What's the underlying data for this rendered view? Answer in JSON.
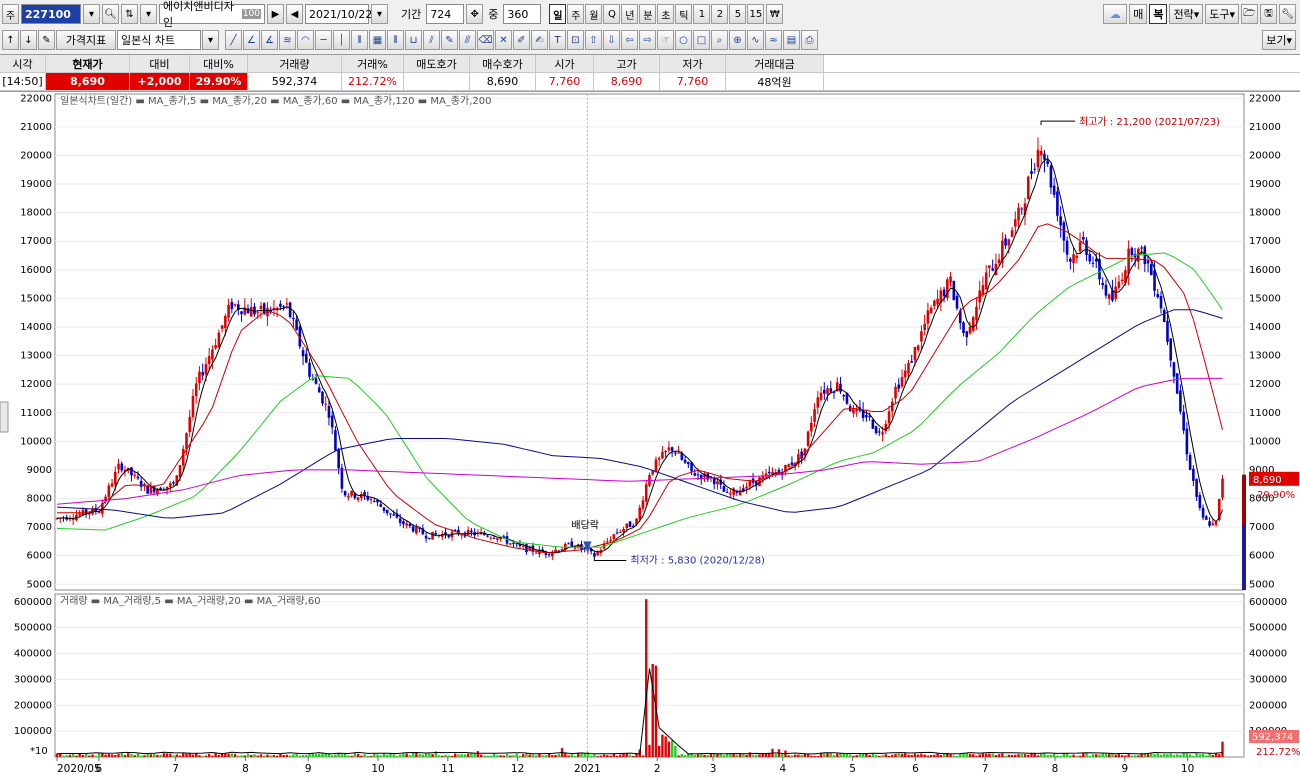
{
  "toolbar": {
    "market_label": "주",
    "code": "227100",
    "stock_name": "에이치앤비디자인",
    "stock_badge": "100",
    "date": "2021/10/22",
    "period_label": "기간",
    "period_value": "724",
    "overlap_label": "중",
    "overlap_value": "360",
    "timeframes": [
      "일",
      "주",
      "월",
      "Q",
      "년",
      "분",
      "초",
      "틱",
      "1",
      "2",
      "5",
      "15"
    ],
    "sell_label": "매",
    "dup_label": "복",
    "strategy_label": "전략",
    "tools_label": "도구",
    "price_indicator": "가격지표",
    "chart_type": "일본식 차트",
    "view_label": "보기"
  },
  "quote": {
    "headers": [
      "시각",
      "현재가",
      "대비",
      "대비%",
      "거래량",
      "거래%",
      "매도호가",
      "매수호가",
      "시가",
      "고가",
      "저가",
      "거래대금"
    ],
    "values": [
      "[14:50]",
      "8,690",
      "+2,000",
      "29.90%",
      "592,374",
      "212.72%",
      "",
      "8,690",
      "7,760",
      "8,690",
      "7,760",
      "48억원"
    ]
  },
  "colors": {
    "up": "#e00000",
    "down": "#0000c8",
    "ma5": "#000000",
    "ma20": "#cc0000",
    "ma60": "#22cc22",
    "ma120": "#0a0a8c",
    "ma200": "#cc00cc"
  },
  "chart_data": {
    "type": "candlestick",
    "price_legend": "일본식차트(일간) ▬ MA_종가,5 ▬ MA_종가,20 ▬ MA_종가,60 ▬ MA_종가,120 ▬ MA_종가,200",
    "volume_legend": "거래량 ▬ MA_거래량,5 ▬ MA_거래량,20 ▬ MA_거래량,60",
    "price_ticks": [
      5000,
      6000,
      7000,
      8000,
      9000,
      10000,
      11000,
      12000,
      13000,
      14000,
      15000,
      16000,
      17000,
      18000,
      19000,
      20000,
      21000,
      22000
    ],
    "price_ylim": [
      4800,
      22150
    ],
    "volume_ticks": [
      100000,
      200000,
      300000,
      400000,
      500000,
      600000
    ],
    "volume_ylim": [
      0,
      630000
    ],
    "volume_scale_label": "*10",
    "x_ticks": [
      "2020/05",
      "6",
      "7",
      "8",
      "9",
      "10",
      "11",
      "12",
      "2021",
      "2",
      "3",
      "4",
      "5",
      "6",
      "7",
      "8",
      "9",
      "10"
    ],
    "x_tick_index": [
      0,
      0.6,
      1.7,
      2.7,
      3.6,
      4.6,
      5.6,
      6.6,
      7.6,
      8.6,
      9.4,
      10.4,
      11.4,
      12.3,
      13.3,
      14.3,
      15.3,
      16.2
    ],
    "price_anchors": [
      [
        0,
        7300
      ],
      [
        0.6,
        7600
      ],
      [
        0.9,
        9200
      ],
      [
        1.3,
        8300
      ],
      [
        1.7,
        8500
      ],
      [
        2.0,
        12000
      ],
      [
        2.5,
        14800
      ],
      [
        2.9,
        14500
      ],
      [
        3.3,
        14700
      ],
      [
        3.6,
        12500
      ],
      [
        3.9,
        11000
      ],
      [
        4.1,
        8200
      ],
      [
        4.5,
        8000
      ],
      [
        4.9,
        7200
      ],
      [
        5.3,
        6700
      ],
      [
        5.8,
        6800
      ],
      [
        6.3,
        6700
      ],
      [
        6.6,
        6300
      ],
      [
        7.0,
        6100
      ],
      [
        7.4,
        6400
      ],
      [
        7.7,
        6000
      ],
      [
        8.0,
        6800
      ],
      [
        8.3,
        7200
      ],
      [
        8.5,
        9000
      ],
      [
        8.8,
        9800
      ],
      [
        9.1,
        8900
      ],
      [
        9.4,
        8700
      ],
      [
        9.6,
        8100
      ],
      [
        10.0,
        8600
      ],
      [
        10.4,
        9000
      ],
      [
        10.7,
        9600
      ],
      [
        10.9,
        11700
      ],
      [
        11.2,
        12000
      ],
      [
        11.4,
        11000
      ],
      [
        11.6,
        10900
      ],
      [
        11.8,
        10200
      ],
      [
        12.0,
        11800
      ],
      [
        12.2,
        12600
      ],
      [
        12.5,
        14500
      ],
      [
        12.8,
        15600
      ],
      [
        13.0,
        13600
      ],
      [
        13.3,
        15700
      ],
      [
        13.6,
        17000
      ],
      [
        13.8,
        18000
      ],
      [
        14.0,
        19800
      ],
      [
        14.1,
        20500
      ],
      [
        14.3,
        18500
      ],
      [
        14.5,
        16300
      ],
      [
        14.7,
        17000
      ],
      [
        14.9,
        16000
      ],
      [
        15.1,
        14800
      ],
      [
        15.4,
        16800
      ],
      [
        15.6,
        16400
      ],
      [
        15.8,
        15000
      ],
      [
        16.0,
        12500
      ],
      [
        16.2,
        9500
      ],
      [
        16.4,
        7300
      ],
      [
        16.6,
        7000
      ],
      [
        16.7,
        8690
      ]
    ],
    "ma20": [
      [
        0,
        7500
      ],
      [
        0.5,
        7500
      ],
      [
        1.0,
        8500
      ],
      [
        1.5,
        8400
      ],
      [
        2.2,
        11000
      ],
      [
        2.6,
        13800
      ],
      [
        3.0,
        14600
      ],
      [
        3.3,
        14300
      ],
      [
        3.8,
        12400
      ],
      [
        4.3,
        10000
      ],
      [
        4.8,
        8200
      ],
      [
        5.4,
        7100
      ],
      [
        6.0,
        6600
      ],
      [
        6.5,
        6300
      ],
      [
        7.0,
        6100
      ],
      [
        7.5,
        6200
      ],
      [
        8.0,
        6500
      ],
      [
        8.4,
        7000
      ],
      [
        8.8,
        8700
      ],
      [
        9.2,
        9000
      ],
      [
        9.6,
        8700
      ],
      [
        10.0,
        8600
      ],
      [
        10.5,
        9000
      ],
      [
        10.9,
        10100
      ],
      [
        11.3,
        11200
      ],
      [
        11.8,
        11000
      ],
      [
        12.2,
        11600
      ],
      [
        12.6,
        13200
      ],
      [
        13.0,
        14800
      ],
      [
        13.4,
        15300
      ],
      [
        13.8,
        16400
      ],
      [
        14.1,
        17700
      ],
      [
        14.5,
        17300
      ],
      [
        15.0,
        16400
      ],
      [
        15.4,
        16400
      ],
      [
        15.8,
        16300
      ],
      [
        16.2,
        15000
      ],
      [
        16.5,
        12300
      ],
      [
        16.7,
        10400
      ]
    ],
    "ma60": [
      [
        0,
        6950
      ],
      [
        0.7,
        6900
      ],
      [
        1.3,
        7400
      ],
      [
        2.0,
        8100
      ],
      [
        2.6,
        9600
      ],
      [
        3.2,
        11400
      ],
      [
        3.7,
        12300
      ],
      [
        4.2,
        12200
      ],
      [
        4.7,
        11000
      ],
      [
        5.3,
        8700
      ],
      [
        5.9,
        7200
      ],
      [
        6.5,
        6500
      ],
      [
        7.2,
        6300
      ],
      [
        7.8,
        6300
      ],
      [
        8.4,
        6800
      ],
      [
        9.0,
        7300
      ],
      [
        9.8,
        7800
      ],
      [
        10.5,
        8500
      ],
      [
        11.2,
        9300
      ],
      [
        11.7,
        9600
      ],
      [
        12.3,
        10400
      ],
      [
        12.9,
        11900
      ],
      [
        13.5,
        13100
      ],
      [
        14.0,
        14400
      ],
      [
        14.5,
        15400
      ],
      [
        15.0,
        16000
      ],
      [
        15.4,
        16500
      ],
      [
        15.9,
        16600
      ],
      [
        16.3,
        16000
      ],
      [
        16.7,
        14600
      ]
    ],
    "ma120": [
      [
        0,
        7700
      ],
      [
        0.8,
        7600
      ],
      [
        1.6,
        7300
      ],
      [
        2.4,
        7500
      ],
      [
        3.2,
        8500
      ],
      [
        4.0,
        9700
      ],
      [
        4.8,
        10100
      ],
      [
        5.6,
        10100
      ],
      [
        6.4,
        9900
      ],
      [
        7.1,
        9500
      ],
      [
        7.8,
        9400
      ],
      [
        8.4,
        9100
      ],
      [
        9.1,
        8500
      ],
      [
        9.8,
        7900
      ],
      [
        10.5,
        7500
      ],
      [
        11.2,
        7700
      ],
      [
        11.8,
        8300
      ],
      [
        12.5,
        9000
      ],
      [
        13.1,
        10200
      ],
      [
        13.7,
        11400
      ],
      [
        14.3,
        12300
      ],
      [
        14.9,
        13200
      ],
      [
        15.5,
        14100
      ],
      [
        16.0,
        14600
      ],
      [
        16.3,
        14600
      ],
      [
        16.7,
        14300
      ]
    ],
    "ma200": [
      [
        0,
        7800
      ],
      [
        1.0,
        8000
      ],
      [
        1.8,
        8300
      ],
      [
        2.6,
        8800
      ],
      [
        3.4,
        9000
      ],
      [
        4.2,
        9000
      ],
      [
        5.2,
        8900
      ],
      [
        6.2,
        8800
      ],
      [
        7.2,
        8700
      ],
      [
        8.2,
        8600
      ],
      [
        9.2,
        8700
      ],
      [
        10.2,
        8800
      ],
      [
        11.0,
        9000
      ],
      [
        11.6,
        9300
      ],
      [
        12.4,
        9200
      ],
      [
        13.2,
        9300
      ],
      [
        14.0,
        10100
      ],
      [
        14.8,
        11000
      ],
      [
        15.5,
        11900
      ],
      [
        16.1,
        12200
      ],
      [
        16.7,
        12200
      ]
    ],
    "annotations": {
      "high": "최고가 : 21,200 (2021/07/23)",
      "low": "최저가 : 5,830 (2020/12/28)",
      "dividend": "배당락"
    },
    "last_price_label": "8,690",
    "last_change_label": "29.90%",
    "last_volume_label": "592,374",
    "last_volume_pct": "212.72%"
  }
}
